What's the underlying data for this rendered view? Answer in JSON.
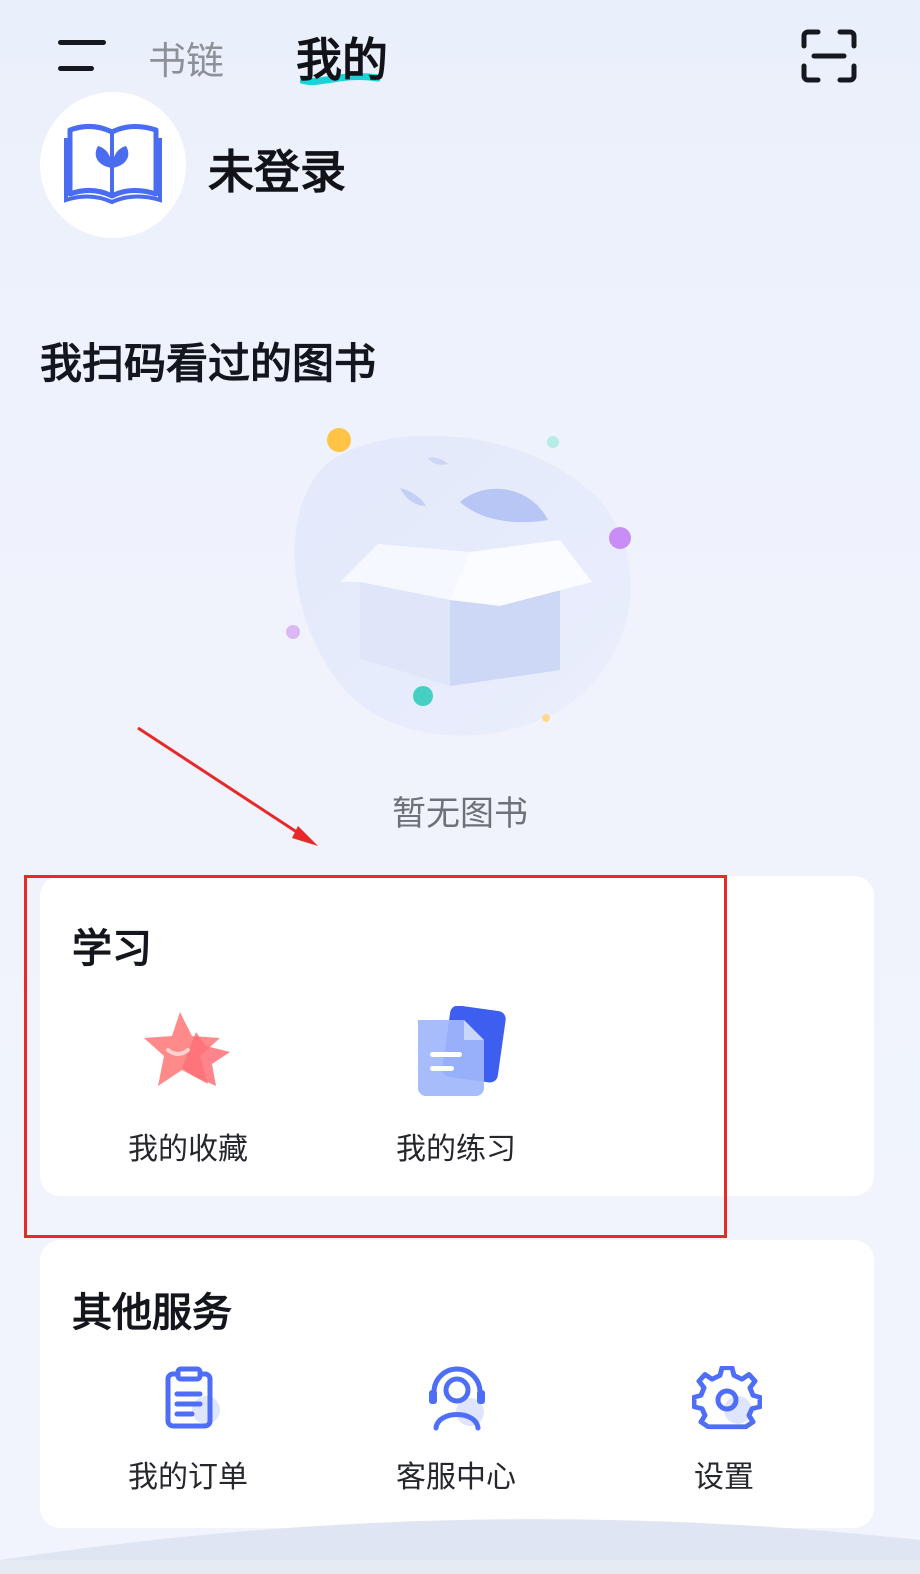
{
  "header": {
    "tabs": [
      {
        "label": "书链"
      },
      {
        "label": "我的"
      }
    ]
  },
  "profile": {
    "status": "未登录"
  },
  "scanned_books": {
    "title": "我扫码看过的图书",
    "empty_text": "暂无图书"
  },
  "study": {
    "title": "学习",
    "items": [
      {
        "label": "我的收藏",
        "icon": "star-icon"
      },
      {
        "label": "我的练习",
        "icon": "document-icon"
      }
    ]
  },
  "services": {
    "title": "其他服务",
    "items": [
      {
        "label": "我的订单",
        "icon": "clipboard-icon"
      },
      {
        "label": "客服中心",
        "icon": "headset-icon"
      },
      {
        "label": "设置",
        "icon": "gear-icon"
      }
    ]
  },
  "colors": {
    "accent_blue": "#4f6ef7",
    "annotation_red": "#e62a2a",
    "tab_underline": "#19d3d8"
  }
}
